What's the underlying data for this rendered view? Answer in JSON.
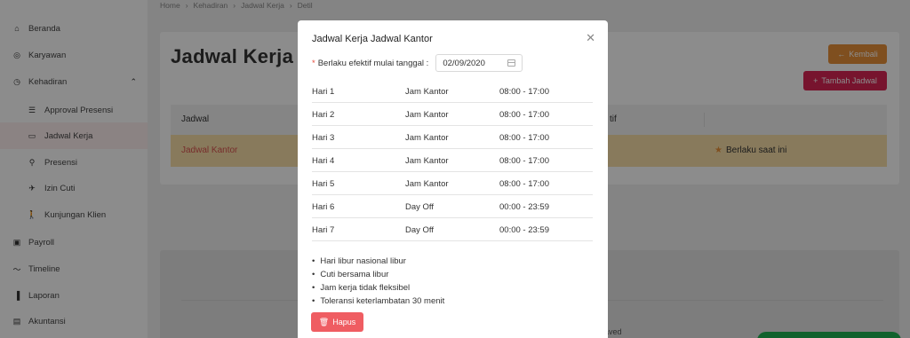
{
  "sidebar": {
    "items": [
      {
        "label": "Beranda",
        "icon": "home-icon",
        "glyph": "⌂"
      },
      {
        "label": "Karyawan",
        "icon": "user-circle-icon",
        "glyph": "◎"
      },
      {
        "label": "Kehadiran",
        "icon": "clock-icon",
        "glyph": "◷"
      },
      {
        "label": "Approval Presensi",
        "icon": "list-check-icon",
        "glyph": "☰"
      },
      {
        "label": "Jadwal Kerja",
        "icon": "calendar-icon",
        "glyph": "▭"
      },
      {
        "label": "Presensi",
        "icon": "user-check-icon",
        "glyph": "⚲"
      },
      {
        "label": "Izin Cuti",
        "icon": "plane-icon",
        "glyph": "✈"
      },
      {
        "label": "Kunjungan Klien",
        "icon": "walk-icon",
        "glyph": "🚶"
      },
      {
        "label": "Payroll",
        "icon": "payroll-icon",
        "glyph": "▣"
      },
      {
        "label": "Timeline",
        "icon": "timeline-icon",
        "glyph": "〜"
      },
      {
        "label": "Laporan",
        "icon": "chart-bar-icon",
        "glyph": "▐"
      },
      {
        "label": "Akuntansi",
        "icon": "book-icon",
        "glyph": "▤"
      }
    ]
  },
  "breadcrumb": [
    "Home",
    "Kehadiran",
    "Jadwal Kerja",
    "Detil"
  ],
  "breadcrumb_sep": "›",
  "page": {
    "title": "Jadwal Kerja ac",
    "back_label": "Kembali",
    "add_label": "Tambah Jadwal",
    "table": {
      "col1": "Jadwal",
      "col2": "tif",
      "row_name": "Jadwal Kantor",
      "row_status": "Berlaku saat ini"
    },
    "saved_text": "aved"
  },
  "modal": {
    "title": "Jadwal Kerja Jadwal Kantor",
    "effective_label": "Berlaku efektif mulai tanggal :",
    "effective_date": "02/09/2020",
    "schedule": [
      {
        "day": "Hari 1",
        "shift": "Jam Kantor",
        "time": "08:00 - 17:00"
      },
      {
        "day": "Hari 2",
        "shift": "Jam Kantor",
        "time": "08:00 - 17:00"
      },
      {
        "day": "Hari 3",
        "shift": "Jam Kantor",
        "time": "08:00 - 17:00"
      },
      {
        "day": "Hari 4",
        "shift": "Jam Kantor",
        "time": "08:00 - 17:00"
      },
      {
        "day": "Hari 5",
        "shift": "Jam Kantor",
        "time": "08:00 - 17:00"
      },
      {
        "day": "Hari 6",
        "shift": "Day Off",
        "time": "00:00 - 23:59"
      },
      {
        "day": "Hari 7",
        "shift": "Day Off",
        "time": "00:00 - 23:59"
      }
    ],
    "notes": [
      "Hari libur nasional libur",
      "Cuti bersama libur",
      "Jam kerja tidak fleksibel",
      "Toleransi keterlambatan 30 menit"
    ],
    "delete_label": "Hapus"
  },
  "colors": {
    "accent_orange": "#e8913a",
    "accent_pink": "#d92654",
    "delete_red": "#ef5d62",
    "highlight_row": "#f7dfa8"
  }
}
